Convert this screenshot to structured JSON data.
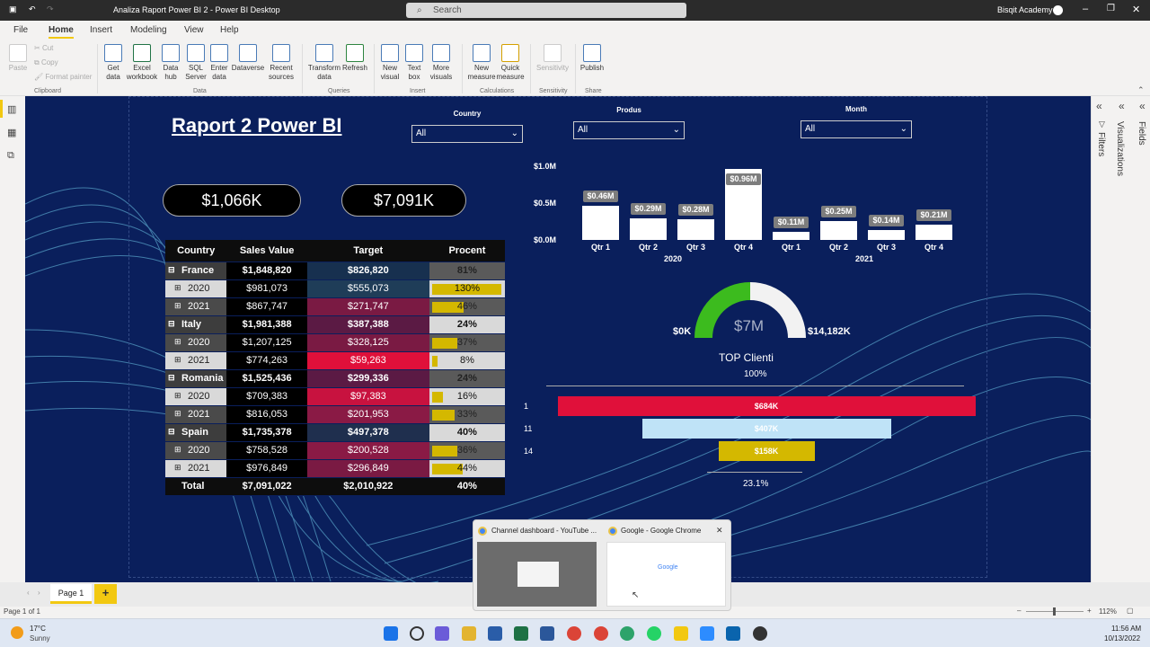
{
  "window": {
    "title": "Analiza Raport Power BI 2 - Power BI Desktop",
    "search_placeholder": "Search",
    "account": "Bisqit Academy"
  },
  "menu": [
    "File",
    "Home",
    "Insert",
    "Modeling",
    "View",
    "Help"
  ],
  "ribbon": {
    "clipboard": {
      "paste": "Paste",
      "cut": "Cut",
      "copy": "Copy",
      "format_painter": "Format painter",
      "group": "Clipboard"
    },
    "data": {
      "items": [
        "Get data",
        "Excel workbook",
        "Data hub",
        "SQL Server",
        "Enter data",
        "Dataverse",
        "Recent sources"
      ],
      "group": "Data"
    },
    "queries": {
      "items": [
        "Transform data",
        "Refresh"
      ],
      "group": "Queries"
    },
    "insert": {
      "items": [
        "New visual",
        "Text box",
        "More visuals"
      ],
      "group": "Insert"
    },
    "calculations": {
      "items": [
        "New measure",
        "Quick measure"
      ],
      "group": "Calculations"
    },
    "sensitivity": {
      "items": [
        "Sensitivity"
      ],
      "group": "Sensitivity"
    },
    "share": {
      "items": [
        "Publish"
      ],
      "group": "Share"
    }
  },
  "panes": {
    "filters": "Filters",
    "visualizations": "Visualizations",
    "fields": "Fields"
  },
  "report": {
    "title": "Raport 2 Power BI",
    "kpi1": "$1,066K",
    "kpi2": "$7,091K",
    "slicers": [
      {
        "label": "Country",
        "value": "All"
      },
      {
        "label": "Produs",
        "value": "All"
      },
      {
        "label": "Month",
        "value": "All"
      }
    ],
    "matrix": {
      "headers": [
        "Country",
        "Sales Value",
        "Target",
        "Procent"
      ],
      "rows": [
        {
          "label": "France",
          "sales": "$1,848,820",
          "target": "$826,820",
          "pct": "81%",
          "level": 0,
          "fill": 0.81
        },
        {
          "label": "2020",
          "sales": "$981,073",
          "target": "$555,073",
          "pct": "130%",
          "level": 1,
          "fill": 1.0
        },
        {
          "label": "2021",
          "sales": "$867,747",
          "target": "$271,747",
          "pct": "46%",
          "level": 1,
          "fill": 0.46
        },
        {
          "label": "Italy",
          "sales": "$1,981,388",
          "target": "$387,388",
          "pct": "24%",
          "level": 0,
          "fill": 0.24
        },
        {
          "label": "2020",
          "sales": "$1,207,125",
          "target": "$328,125",
          "pct": "37%",
          "level": 1,
          "fill": 0.37
        },
        {
          "label": "2021",
          "sales": "$774,263",
          "target": "$59,263",
          "pct": "8%",
          "level": 1,
          "fill": 0.08
        },
        {
          "label": "Romania",
          "sales": "$1,525,436",
          "target": "$299,336",
          "pct": "24%",
          "level": 0,
          "fill": 0.24
        },
        {
          "label": "2020",
          "sales": "$709,383",
          "target": "$97,383",
          "pct": "16%",
          "level": 1,
          "fill": 0.16
        },
        {
          "label": "2021",
          "sales": "$816,053",
          "target": "$201,953",
          "pct": "33%",
          "level": 1,
          "fill": 0.33
        },
        {
          "label": "Spain",
          "sales": "$1,735,378",
          "target": "$497,378",
          "pct": "40%",
          "level": 0,
          "fill": 0.4
        },
        {
          "label": "2020",
          "sales": "$758,528",
          "target": "$200,528",
          "pct": "36%",
          "level": 1,
          "fill": 0.36
        },
        {
          "label": "2021",
          "sales": "$976,849",
          "target": "$296,849",
          "pct": "44%",
          "level": 1,
          "fill": 0.44
        }
      ],
      "total": {
        "label": "Total",
        "sales": "$7,091,022",
        "target": "$2,010,922",
        "pct": "40%"
      }
    },
    "gauge": {
      "min": "$0K",
      "max": "$14,182K",
      "value": "$7M",
      "fraction": 0.5
    },
    "funnel": {
      "title": "TOP Clienti",
      "top_pct": "100%",
      "bottom_pct": "23.1%"
    }
  },
  "chart_data": [
    {
      "type": "bar",
      "categories": [
        "Qtr 1",
        "Qtr 2",
        "Qtr 3",
        "Qtr 4",
        "Qtr 1",
        "Qtr 2",
        "Qtr 3",
        "Qtr 4"
      ],
      "groups": [
        "2020",
        "2021"
      ],
      "values": [
        0.46,
        0.29,
        0.28,
        0.96,
        0.11,
        0.25,
        0.14,
        0.21
      ],
      "labels": [
        "$0.46M",
        "$0.29M",
        "$0.28M",
        "$0.96M",
        "$0.11M",
        "$0.25M",
        "$0.14M",
        "$0.21M"
      ],
      "yticks": [
        "$1.0M",
        "$0.5M",
        "$0.0M"
      ],
      "ylim": [
        0,
        1.0
      ]
    },
    {
      "type": "bar",
      "orientation": "horizontal",
      "categories": [
        "1",
        "11",
        "14"
      ],
      "values": [
        684,
        407,
        158
      ],
      "labels": [
        "$684K",
        "$407K",
        "$158K"
      ],
      "colors": [
        "#e0103a",
        "#bfe3f7",
        "#d4b800"
      ]
    }
  ],
  "tabs": {
    "page": "Page 1",
    "add": "+"
  },
  "status": {
    "page_of": "Page 1 of 1",
    "zoom": "112%"
  },
  "taskbar": {
    "temp": "17°C",
    "weather": "Sunny",
    "time": "11:56 AM",
    "date": "10/13/2022"
  },
  "popup": {
    "item1": "Channel dashboard - YouTube ...",
    "item2": "Google - Google Chrome",
    "thumb2": "Google"
  }
}
